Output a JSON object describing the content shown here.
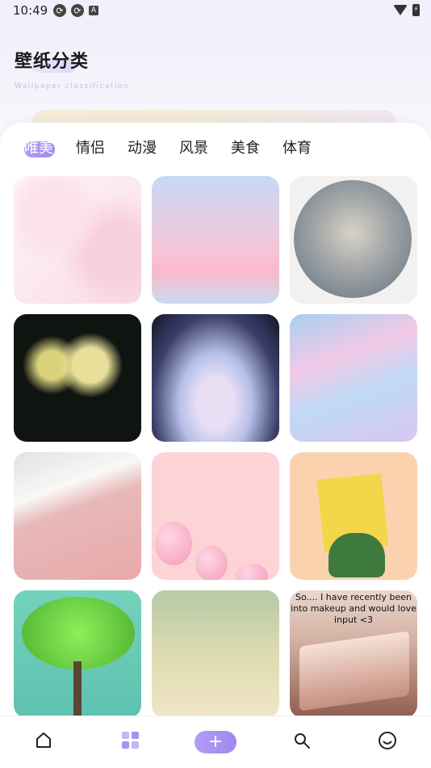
{
  "status": {
    "time": "10:49"
  },
  "header": {
    "title": "壁纸分类",
    "subtitle": "Wallpaper classification"
  },
  "tabs": [
    {
      "label": "唯美",
      "active": true
    },
    {
      "label": "情侣"
    },
    {
      "label": "动漫"
    },
    {
      "label": "风景"
    },
    {
      "label": "美食"
    },
    {
      "label": "体育"
    }
  ],
  "tiles": [
    {
      "name": "anime-girl-umbrella-sakura"
    },
    {
      "name": "couple-beach-moon"
    },
    {
      "name": "cherry-blossom-moon"
    },
    {
      "name": "yellow-flowers-dark"
    },
    {
      "name": "glowing-veil"
    },
    {
      "name": "pastel-clouds"
    },
    {
      "name": "pink-beach-waves"
    },
    {
      "name": "pink-balloons"
    },
    {
      "name": "man-carrying-box"
    },
    {
      "name": "green-tree-teal"
    },
    {
      "name": "vintage-scene"
    },
    {
      "name": "open-book",
      "caption": "So.... I have recently been into makeup and would love input <3"
    }
  ],
  "nav": {
    "items": [
      "home-icon",
      "category-icon",
      "add-icon",
      "discover-icon",
      "profile-icon"
    ],
    "plus": "+"
  },
  "colors": {
    "accent": "#a792f0"
  }
}
